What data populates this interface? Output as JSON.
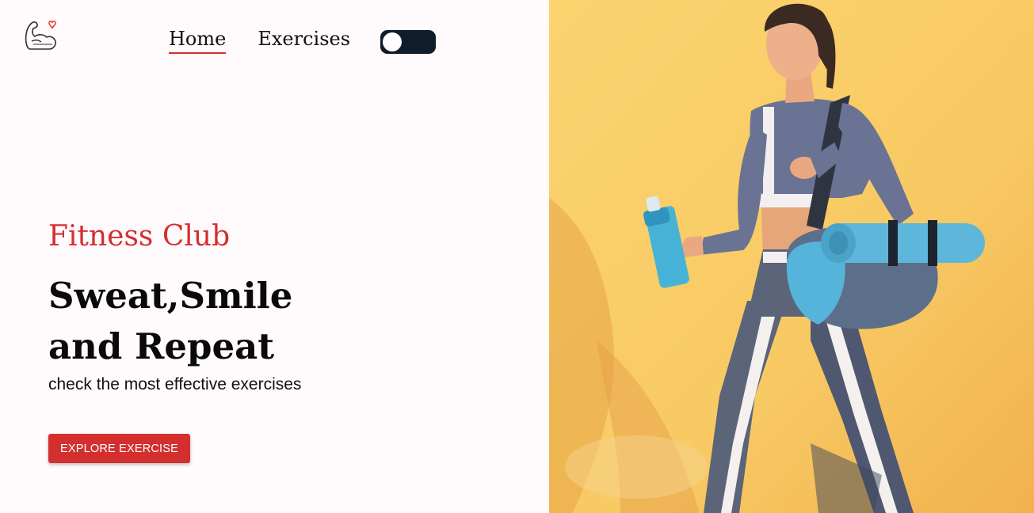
{
  "nav": {
    "home_label": "Home",
    "exercises_label": "Exercises",
    "theme_toggle": "off"
  },
  "logo": {
    "icon": "flexed-bicep-heart-icon"
  },
  "hero": {
    "kicker": "Fitness Club",
    "headline_line1": "Sweat,Smile",
    "headline_line2": "and Repeat",
    "subtitle": "check the most effective exercises",
    "cta_label": "EXPLORE EXERCISE",
    "image": "woman-with-gym-bag-and-bottle-photo"
  },
  "colors": {
    "accent": "#d32f2f",
    "page_background": "#fffafb",
    "toggle_background": "#0f1c2a",
    "image_background": "#f7c766"
  }
}
